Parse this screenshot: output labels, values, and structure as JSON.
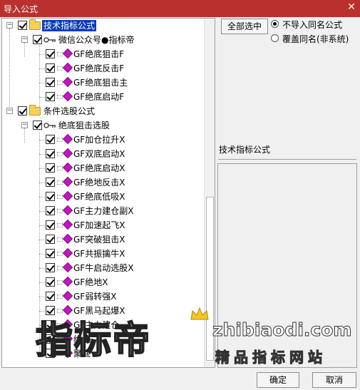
{
  "window": {
    "title": "导入公式",
    "close_glyph": "✕"
  },
  "tree": {
    "root1": {
      "label": "技术指标公式",
      "group": {
        "label": "微信公众号●指标帝",
        "items": [
          "GF绝底狙击F",
          "GF绝底反击F",
          "GF绝底狙击主",
          "GF绝底启动F"
        ]
      }
    },
    "root2": {
      "label": "条件选股公式",
      "group": {
        "label": "绝底狙击选股",
        "items": [
          "GF加仓拉升X",
          "GF双底启动X",
          "GF绝底启动X",
          "GF绝地反击X",
          "GF绝底低吸X",
          "GF主力建仓副X",
          "GF加速起飞X",
          "GF突破狙击X",
          "GF共振擒牛X",
          "GF牛启动选股X",
          "GF绝地X",
          "GF弱转强X",
          "GF黑马起爆X",
          "GF主力建仓",
          "绝地",
          "聚底"
        ]
      }
    }
  },
  "actions": {
    "select_all": "全部选中",
    "radio_options": [
      "不导入同名公式",
      "覆盖同名(非系统)"
    ],
    "selected_radio": 0,
    "ok": "确定",
    "cancel": "取消"
  },
  "detail": {
    "label": "技术指标公式"
  },
  "watermark": {
    "brand": "指标帝",
    "url": "zhibiaodi.com",
    "slogan": "精品指标网站"
  },
  "colors": {
    "titlebar": "#b9302e",
    "selection": "#0a3cb8",
    "formula_gem": "#c514c5",
    "folder": "#f3d15c"
  }
}
